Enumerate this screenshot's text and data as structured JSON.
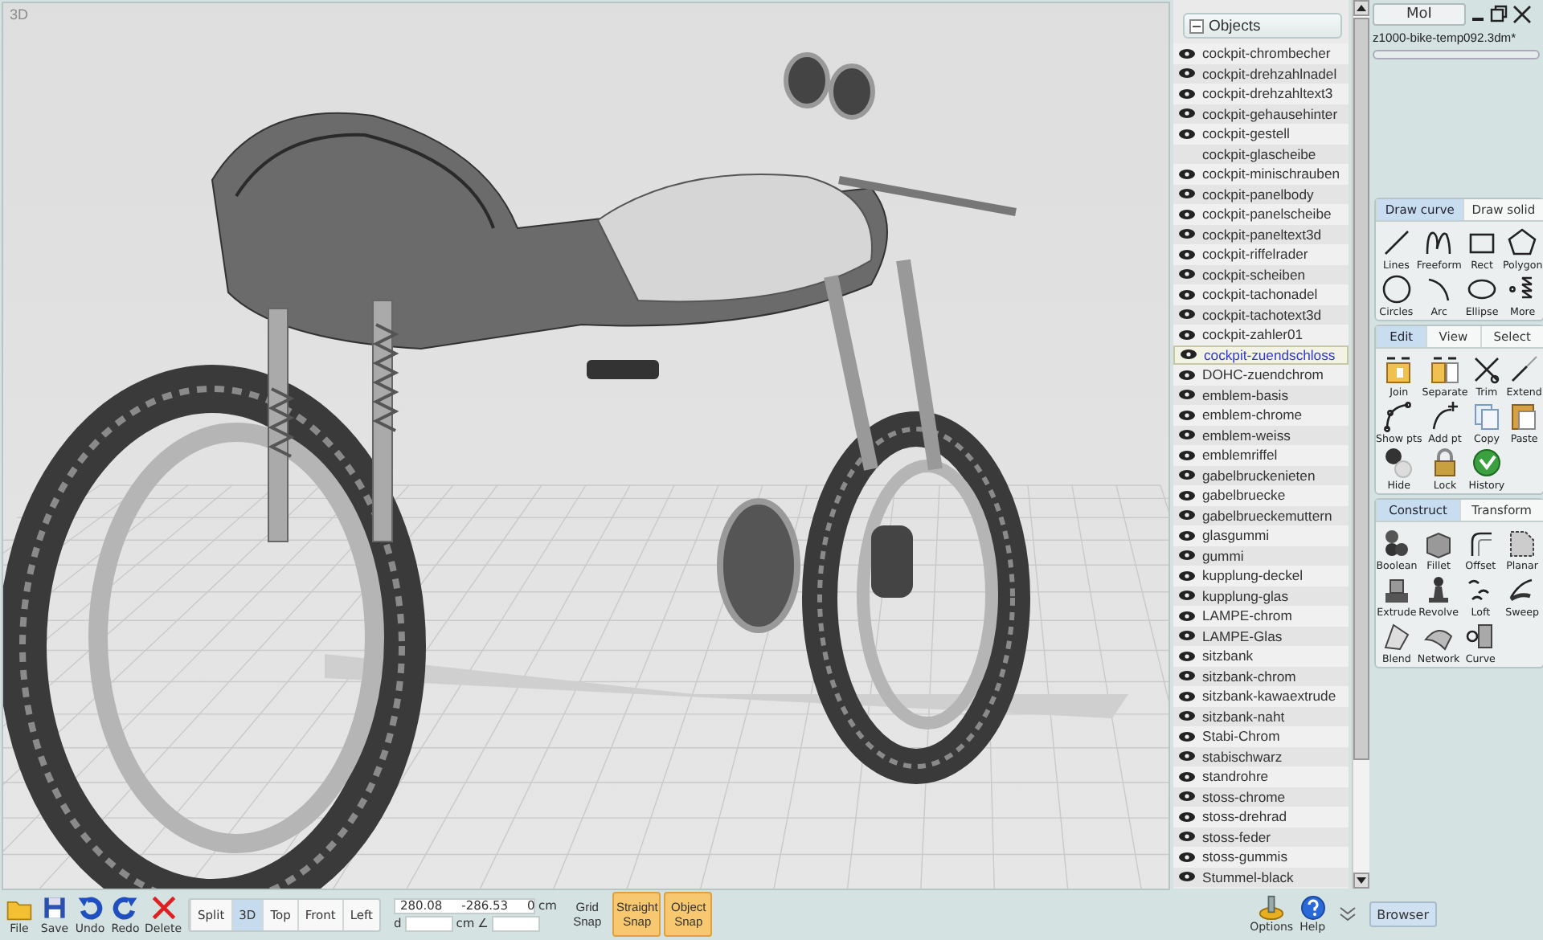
{
  "viewport": {
    "label": "3D"
  },
  "objects_panel": {
    "title": "Objects",
    "items": [
      {
        "name": "cockpit-chrombecher",
        "visible": true,
        "selected": false
      },
      {
        "name": "cockpit-drehzahlnadel",
        "visible": true,
        "selected": false
      },
      {
        "name": "cockpit-drehzahltext3",
        "visible": true,
        "selected": false
      },
      {
        "name": "cockpit-gehausehinter",
        "visible": true,
        "selected": false
      },
      {
        "name": "cockpit-gestell",
        "visible": true,
        "selected": false
      },
      {
        "name": "cockpit-glascheibe",
        "visible": false,
        "selected": false
      },
      {
        "name": "cockpit-minischrauben",
        "visible": true,
        "selected": false
      },
      {
        "name": "cockpit-panelbody",
        "visible": true,
        "selected": false
      },
      {
        "name": "cockpit-panelscheibe",
        "visible": true,
        "selected": false
      },
      {
        "name": "cockpit-paneltext3d",
        "visible": true,
        "selected": false
      },
      {
        "name": "cockpit-riffelrader",
        "visible": true,
        "selected": false
      },
      {
        "name": "cockpit-scheiben",
        "visible": true,
        "selected": false
      },
      {
        "name": "cockpit-tachonadel",
        "visible": true,
        "selected": false
      },
      {
        "name": "cockpit-tachotext3d",
        "visible": true,
        "selected": false
      },
      {
        "name": "cockpit-zahler01",
        "visible": true,
        "selected": false
      },
      {
        "name": "cockpit-zuendschloss",
        "visible": true,
        "selected": true
      },
      {
        "name": "DOHC-zuendchrom",
        "visible": true,
        "selected": false
      },
      {
        "name": "emblem-basis",
        "visible": true,
        "selected": false
      },
      {
        "name": "emblem-chrome",
        "visible": true,
        "selected": false
      },
      {
        "name": "emblem-weiss",
        "visible": true,
        "selected": false
      },
      {
        "name": "emblemriffel",
        "visible": true,
        "selected": false
      },
      {
        "name": "gabelbruckenieten",
        "visible": true,
        "selected": false
      },
      {
        "name": "gabelbruecke",
        "visible": true,
        "selected": false
      },
      {
        "name": "gabelbrueckemuttern",
        "visible": true,
        "selected": false
      },
      {
        "name": "glasgummi",
        "visible": true,
        "selected": false
      },
      {
        "name": "gummi",
        "visible": true,
        "selected": false
      },
      {
        "name": "kupplung-deckel",
        "visible": true,
        "selected": false
      },
      {
        "name": "kupplung-glas",
        "visible": true,
        "selected": false
      },
      {
        "name": "LAMPE-chrom",
        "visible": true,
        "selected": false
      },
      {
        "name": "LAMPE-Glas",
        "visible": true,
        "selected": false
      },
      {
        "name": "sitzbank",
        "visible": true,
        "selected": false
      },
      {
        "name": "sitzbank-chrom",
        "visible": true,
        "selected": false
      },
      {
        "name": "sitzbank-kawaextrude",
        "visible": true,
        "selected": false
      },
      {
        "name": "sitzbank-naht",
        "visible": true,
        "selected": false
      },
      {
        "name": "Stabi-Chrom",
        "visible": true,
        "selected": false
      },
      {
        "name": "stabischwarz",
        "visible": true,
        "selected": false
      },
      {
        "name": "standrohre",
        "visible": true,
        "selected": false
      },
      {
        "name": "stoss-chrome",
        "visible": true,
        "selected": false
      },
      {
        "name": "stoss-drehrad",
        "visible": true,
        "selected": false
      },
      {
        "name": "stoss-feder",
        "visible": true,
        "selected": false
      },
      {
        "name": "stoss-gummis",
        "visible": true,
        "selected": false
      },
      {
        "name": "Stummel-black",
        "visible": true,
        "selected": false
      }
    ]
  },
  "app_panel": {
    "title": "MoI",
    "file_name": "z1000-bike-temp092.3dm*",
    "progress": {
      "level": 0
    }
  },
  "palettes": [
    {
      "tabs": [
        {
          "label": "Draw curve",
          "selected": true
        },
        {
          "label": "Draw solid",
          "selected": false
        }
      ],
      "tools": [
        "Lines",
        "Freeform",
        "Rect",
        "Polygon",
        "Circles",
        "Arc",
        "Ellipse",
        "More"
      ]
    },
    {
      "tabs": [
        {
          "label": "Edit",
          "selected": true
        },
        {
          "label": "View",
          "selected": false
        },
        {
          "label": "Select",
          "selected": false
        }
      ],
      "tools": [
        "Join",
        "Separate",
        "Trim",
        "Extend",
        "Show pts",
        "Add pt",
        "Copy",
        "Paste",
        "Hide",
        "Lock",
        "History"
      ]
    },
    {
      "tabs": [
        {
          "label": "Construct",
          "selected": true
        },
        {
          "label": "Transform",
          "selected": false
        }
      ],
      "tools": [
        "Boolean",
        "Fillet",
        "Offset",
        "Planar",
        "Extrude",
        "Revolve",
        "Loft",
        "Sweep",
        "Blend",
        "Network",
        "Curve"
      ]
    }
  ],
  "bottom_toolbar": {
    "file_buttons": [
      "File",
      "Save",
      "Undo",
      "Redo",
      "Delete"
    ],
    "view_buttons": [
      {
        "label": "Split",
        "selected": false
      },
      {
        "label": "3D",
        "selected": true
      },
      {
        "label": "Top",
        "selected": false
      },
      {
        "label": "Front",
        "selected": false
      },
      {
        "label": "Left",
        "selected": false
      }
    ],
    "coordinates": {
      "value": "280.08     -286.53     0",
      "unit": "cm"
    },
    "distance": {
      "label": "d",
      "unit": "cm",
      "angle_symbol": "∠"
    },
    "snaps": [
      {
        "label": "Grid Snap",
        "on": false
      },
      {
        "label": "Straight Snap",
        "on": true
      },
      {
        "label": "Object Snap",
        "on": true
      }
    ],
    "utility_buttons": [
      "Options",
      "Help"
    ],
    "browser_button": "Browser"
  }
}
